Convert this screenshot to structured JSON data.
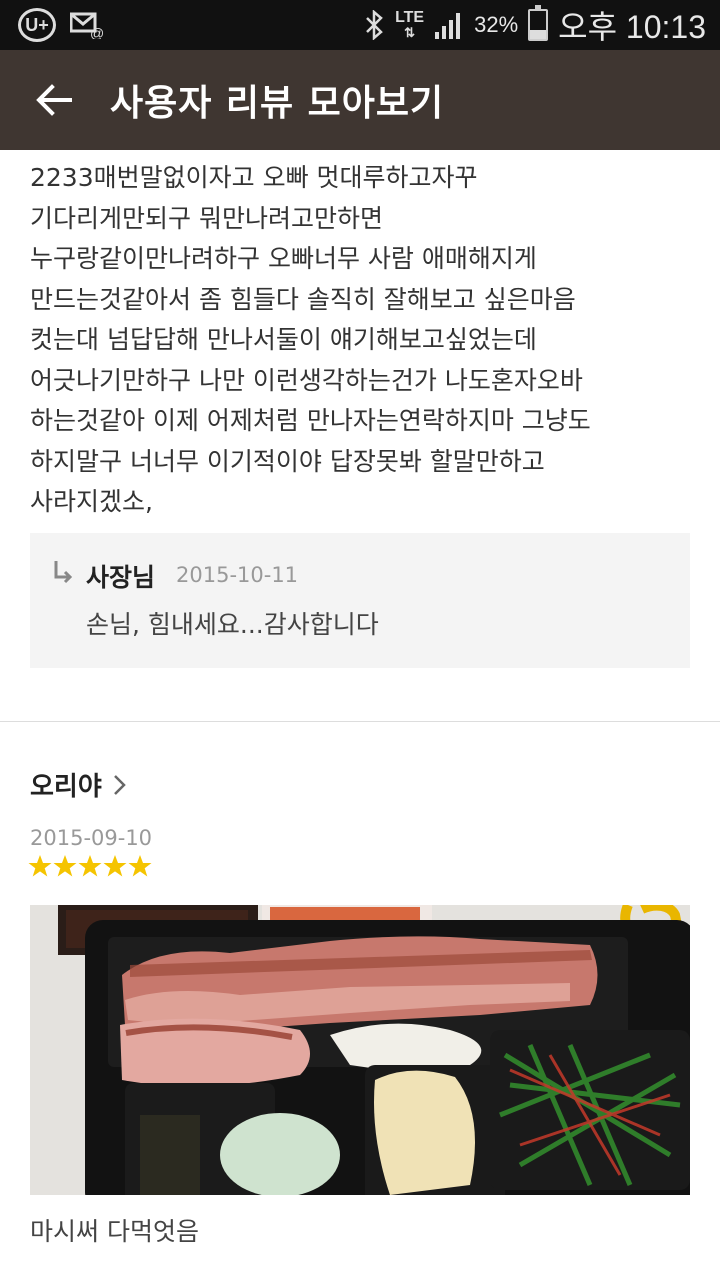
{
  "status_bar": {
    "carrier_logo": "U+",
    "network": "LTE",
    "battery": "32%",
    "battery_level": 0.32,
    "time": "오후 10:13"
  },
  "app_bar": {
    "title": "사용자 리뷰 모아보기"
  },
  "review": {
    "body": "2233매번말없이자고 오빠 멋대루하고자꾸\n기다리게만되구 뭐만나려고만하면\n누구랑같이만나려하구 오빠너무 사람  애매해지게\n만드는것같아서 좀 힘들다 솔직히 잘해보고 싶은마음\n컷는대 넘답답해 만나서둘이 얘기해보고싶었는데\n어긋나기만하구 나만 이런생각하는건가 나도혼자오바\n하는것같아 이제 어제처럼 만나자는연락하지마 그냥도\n하지말구 너너무 이기적이야 답장못봐 할말만하고\n사라지겠소,",
    "reply": {
      "author": "사장님",
      "date": "2015-10-11",
      "text": "손님, 힘내세요...감사합니다"
    }
  },
  "next_review": {
    "user": "오리야",
    "date": "2015-09-10",
    "rating": 5,
    "max_rating": 5,
    "caption": "마시써 다먹엇음"
  },
  "colors": {
    "app_bar": "#3f3631",
    "star": "#f5c400",
    "reply_bg": "#f4f4f4"
  }
}
